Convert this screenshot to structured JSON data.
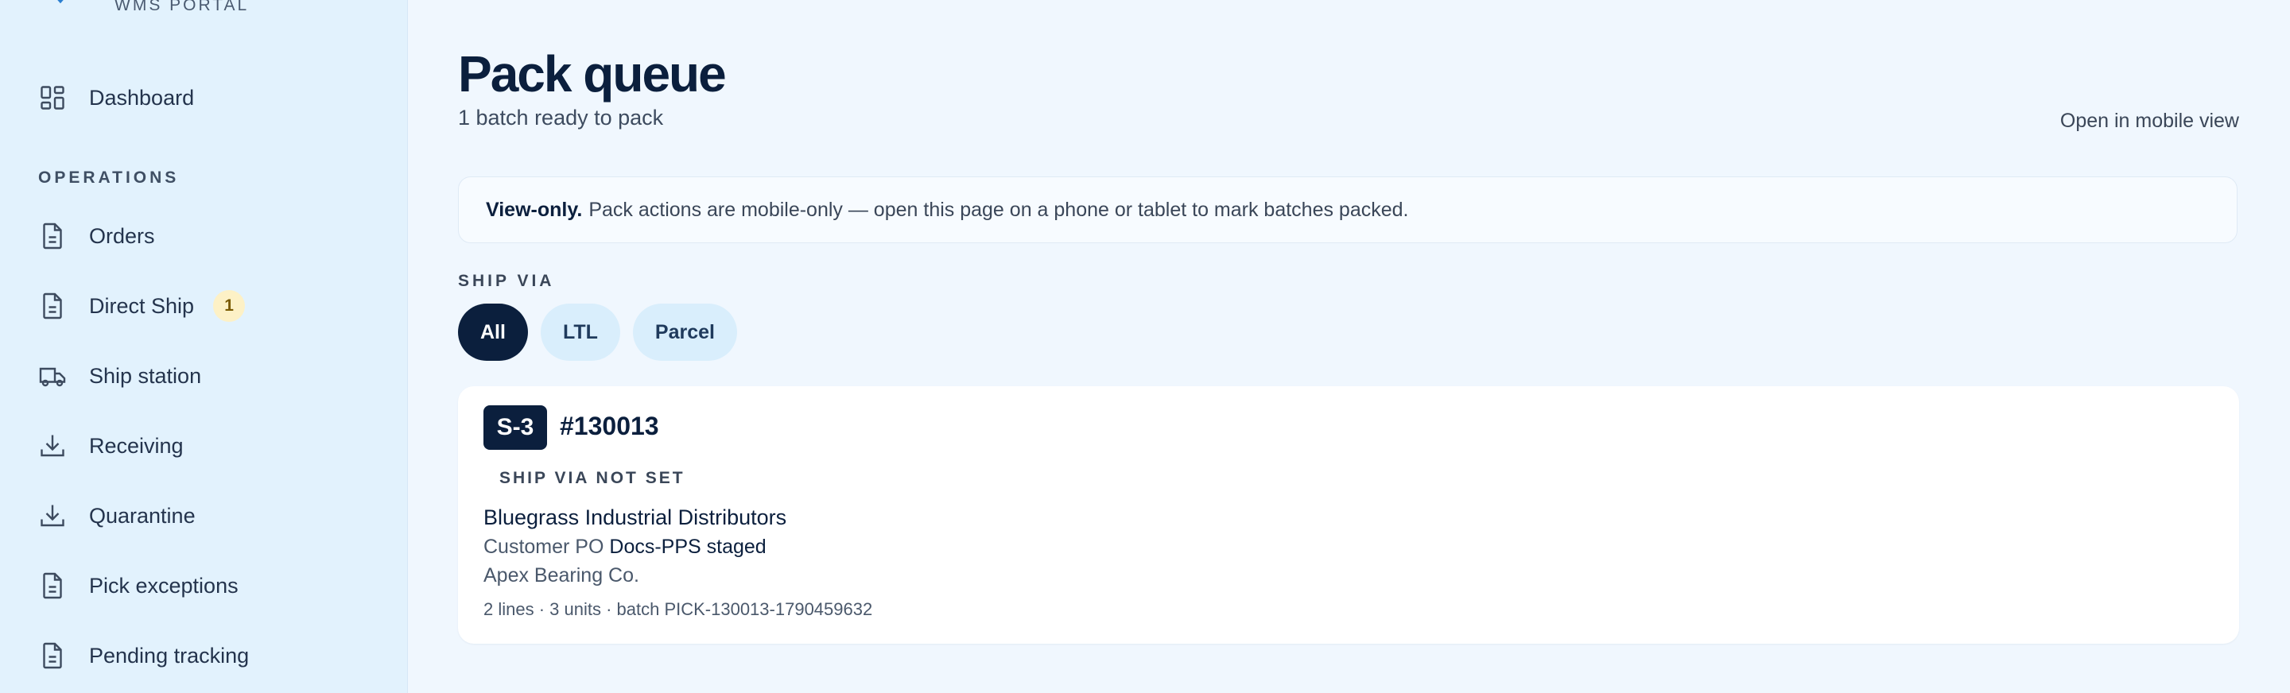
{
  "brand": {
    "subtitle": "WMS PORTAL"
  },
  "sidebar": {
    "dashboard_label": "Dashboard",
    "section_label": "OPERATIONS",
    "items": [
      {
        "label": "Orders",
        "icon": "document-icon"
      },
      {
        "label": "Direct Ship",
        "icon": "document-icon",
        "badge": "1"
      },
      {
        "label": "Ship station",
        "icon": "truck-icon"
      },
      {
        "label": "Receiving",
        "icon": "download-tray-icon"
      },
      {
        "label": "Quarantine",
        "icon": "download-tray-icon"
      },
      {
        "label": "Pick exceptions",
        "icon": "document-icon"
      },
      {
        "label": "Pending tracking",
        "icon": "document-icon"
      }
    ]
  },
  "header": {
    "title": "Pack queue",
    "subtitle": "1 batch ready to pack",
    "mobile_link": "Open in mobile view"
  },
  "notice": {
    "strong": "View-only.",
    "text": "Pack actions are mobile-only — open this page on a phone or tablet to mark batches packed."
  },
  "filters": {
    "label": "SHIP VIA",
    "chips": [
      "All",
      "LTL",
      "Parcel"
    ],
    "selected": "All"
  },
  "batches": [
    {
      "stage": "S-3",
      "order_no": "#130013",
      "ship_via": "SHIP VIA NOT SET",
      "customer": "Bluegrass Industrial Distributors",
      "po_label": "Customer PO",
      "po_value": "Docs-PPS staged",
      "supplier": "Apex Bearing Co.",
      "meta": "2 lines · 3 units · batch PICK-130013-1790459632"
    }
  ],
  "colors": {
    "accent": "#0b1f3d",
    "sidebar_bg": "#e2f2fd",
    "page_bg": "#f0f7fe",
    "badge_bg": "#fdf1c6"
  }
}
